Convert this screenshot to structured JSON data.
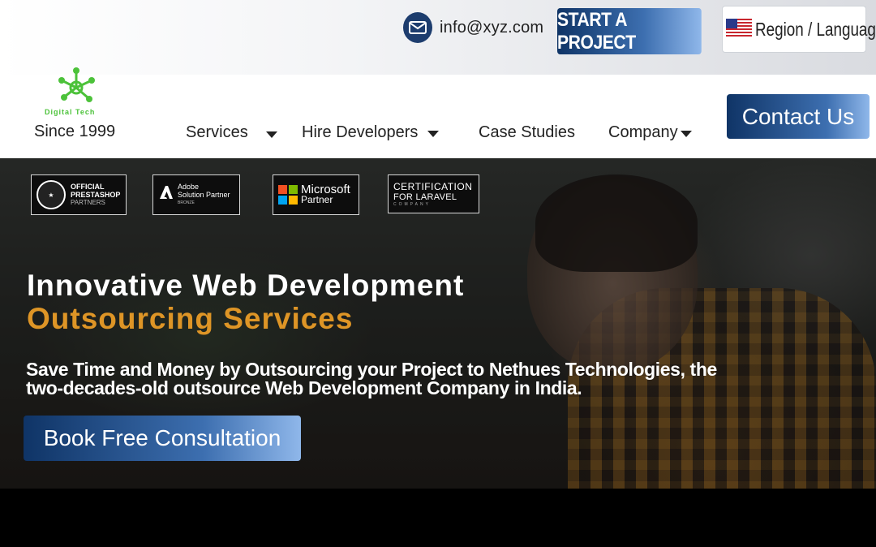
{
  "topbar": {
    "email": "info@xyz.com",
    "start_project_label": "START A PROJECT",
    "region_label": "Region / Language"
  },
  "header": {
    "logo_text": "Digital Tech",
    "since_label": "Since 1999",
    "nav": [
      {
        "label": "Services",
        "has_dropdown": true
      },
      {
        "label": "Hire Developers",
        "has_dropdown": true
      },
      {
        "label": "Case Studies",
        "has_dropdown": false
      },
      {
        "label": "Company",
        "has_dropdown": true
      }
    ],
    "contact_label": "Contact Us"
  },
  "badges": {
    "prestashop": {
      "line1": "OFFICIAL",
      "line2": "PRESTASHOP",
      "line3": "PARTNERS"
    },
    "adobe": {
      "line1": "Adobe",
      "line2": "Solution Partner",
      "line3": "BRONZE"
    },
    "microsoft": {
      "line1": "Microsoft",
      "line2": "Partner"
    },
    "laravel": {
      "line1": "CERTIFICATION",
      "line2": "FOR LARAVEL",
      "line3": "COMPANY"
    }
  },
  "hero": {
    "title_line1": "Innovative Web Development",
    "title_line2": "Outsourcing Services",
    "subtitle": "Save Time and Money by Outsourcing your Project to Nethues Technologies, the two-decades-old outsource Web Development Company in India.",
    "cta_label": "Book Free Consultation"
  },
  "colors": {
    "accent_orange": "#de9526",
    "button_dark": "#0f3466",
    "button_light": "#8fb7ea",
    "logo_green": "#4cc23a"
  },
  "icons": [
    "mail-icon",
    "us-flag-icon",
    "chevron-down-icon",
    "logo-molecule-icon",
    "microsoft-logo-icon",
    "adobe-logo-icon"
  ]
}
